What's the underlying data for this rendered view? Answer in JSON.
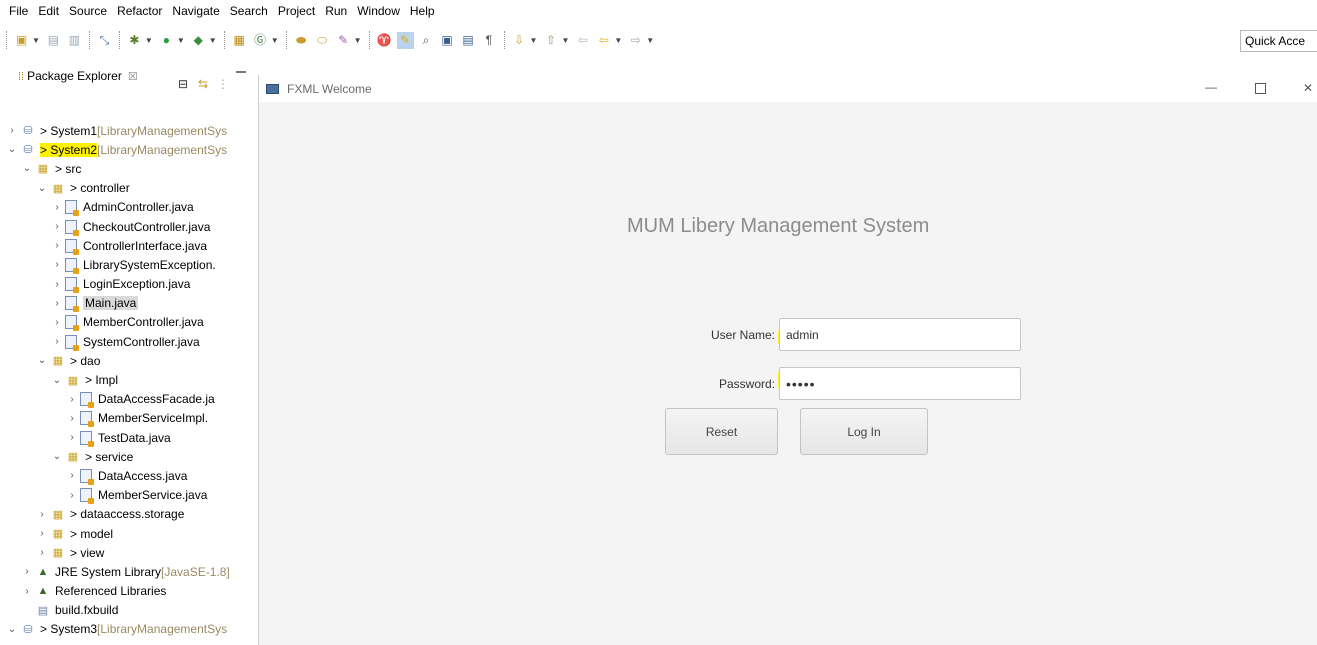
{
  "menu": [
    "File",
    "Edit",
    "Source",
    "Refactor",
    "Navigate",
    "Search",
    "Project",
    "Run",
    "Window",
    "Help"
  ],
  "toolbar": {
    "quick_access": "Quick Acce"
  },
  "explorer": {
    "title": "Package Explorer",
    "close_glyph": "☒"
  },
  "tree": [
    {
      "label": "> System1",
      "dim": " [LibraryManagementSys",
      "arrow": "›",
      "icon": "project",
      "indent": 0
    },
    {
      "label": "> System2",
      "dim": " [LibraryManagementSys",
      "arrow": "⌄",
      "icon": "project",
      "indent": 0,
      "highlight": true
    },
    {
      "label": "> src",
      "dim": "",
      "arrow": "⌄",
      "icon": "pkgroot",
      "indent": 1
    },
    {
      "label": "> controller",
      "dim": "",
      "arrow": "⌄",
      "icon": "pkg",
      "indent": 2
    },
    {
      "label": "AdminController.java",
      "dim": "",
      "arrow": "›",
      "icon": "java",
      "indent": 3
    },
    {
      "label": "CheckoutController.java",
      "dim": "",
      "arrow": "›",
      "icon": "java",
      "indent": 3
    },
    {
      "label": "ControllerInterface.java",
      "dim": "",
      "arrow": "›",
      "icon": "java",
      "indent": 3
    },
    {
      "label": "LibrarySystemException.",
      "dim": "",
      "arrow": "›",
      "icon": "java",
      "indent": 3
    },
    {
      "label": "LoginException.java",
      "dim": "",
      "arrow": "›",
      "icon": "java",
      "indent": 3
    },
    {
      "label": "Main.java",
      "dim": "",
      "arrow": "›",
      "icon": "java",
      "indent": 3,
      "selected": true
    },
    {
      "label": "MemberController.java",
      "dim": "",
      "arrow": "›",
      "icon": "java",
      "indent": 3
    },
    {
      "label": "SystemController.java",
      "dim": "",
      "arrow": "›",
      "icon": "java",
      "indent": 3
    },
    {
      "label": "> dao",
      "dim": "",
      "arrow": "⌄",
      "icon": "pkg",
      "indent": 2
    },
    {
      "label": "> Impl",
      "dim": "",
      "arrow": "⌄",
      "icon": "pkg",
      "indent": 3
    },
    {
      "label": "DataAccessFacade.ja",
      "dim": "",
      "arrow": "›",
      "icon": "java",
      "indent": 4
    },
    {
      "label": "MemberServiceImpl.",
      "dim": "",
      "arrow": "›",
      "icon": "java",
      "indent": 4
    },
    {
      "label": "TestData.java",
      "dim": "",
      "arrow": "›",
      "icon": "java",
      "indent": 4
    },
    {
      "label": "> service",
      "dim": "",
      "arrow": "⌄",
      "icon": "pkg",
      "indent": 3
    },
    {
      "label": "DataAccess.java",
      "dim": "",
      "arrow": "›",
      "icon": "java",
      "indent": 4
    },
    {
      "label": "MemberService.java",
      "dim": "",
      "arrow": "›",
      "icon": "java",
      "indent": 4
    },
    {
      "label": "> dataaccess.storage",
      "dim": "",
      "arrow": "›",
      "icon": "pkg",
      "indent": 2
    },
    {
      "label": "> model",
      "dim": "",
      "arrow": "›",
      "icon": "pkg",
      "indent": 2
    },
    {
      "label": "> view",
      "dim": "",
      "arrow": "›",
      "icon": "pkg",
      "indent": 2
    },
    {
      "label": "JRE System Library",
      "dim": " [JavaSE-1.8]",
      "arrow": "›",
      "icon": "lib",
      "indent": 1
    },
    {
      "label": "Referenced Libraries",
      "dim": "",
      "arrow": "›",
      "icon": "lib",
      "indent": 1
    },
    {
      "label": "build.fxbuild",
      "dim": "",
      "arrow": "",
      "icon": "file",
      "indent": 1
    },
    {
      "label": "> System3",
      "dim": " [LibraryManagementSys",
      "arrow": "⌄",
      "icon": "project",
      "indent": 0
    }
  ],
  "fx_window": {
    "title": "FXML Welcome",
    "min_glyph": "—",
    "close_glyph": "✕",
    "heading": "MUM Libery Management System",
    "username_label": "User Name:",
    "username_value": "admin",
    "password_label": "Password:",
    "password_value": "•••••",
    "reset_label": "Reset",
    "login_label": "Log In"
  },
  "colors": {
    "highlight": "#fff200",
    "heading": "#8c8c8c",
    "window_bg": "#f4f4f4"
  }
}
